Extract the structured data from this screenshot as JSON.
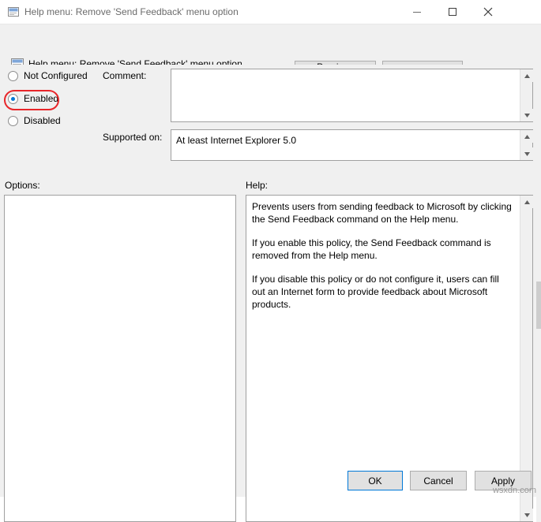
{
  "window": {
    "title": "Help menu: Remove 'Send Feedback' menu option",
    "icon": "policy-setting-icon",
    "minimize_icon": "minimize-icon",
    "maximize_icon": "maximize-icon",
    "close_icon": "close-icon"
  },
  "header": {
    "icon": "policy-setting-icon",
    "title": "Help menu: Remove 'Send Feedback' menu option",
    "previous_label": "Previous Setting",
    "next_label": "Next Setting"
  },
  "state_options": [
    {
      "label": "Not Configured",
      "checked": false
    },
    {
      "label": "Enabled",
      "checked": true
    },
    {
      "label": "Disabled",
      "checked": false
    }
  ],
  "labels": {
    "comment": "Comment:",
    "supported_on": "Supported on:",
    "options": "Options:",
    "help": "Help:"
  },
  "comment": {
    "value": "",
    "placeholder": ""
  },
  "supported_on": {
    "value": "At least Internet Explorer 5.0"
  },
  "help": {
    "paragraphs": [
      "Prevents users from sending feedback to Microsoft by clicking the Send Feedback command on the Help menu.",
      "If you enable this policy, the Send Feedback command is removed from the Help menu.",
      "If you disable this policy or do not configure it, users can fill out an Internet form to provide feedback about Microsoft products."
    ]
  },
  "buttons": {
    "ok": "OK",
    "cancel": "Cancel",
    "apply": "Apply"
  },
  "annotation": {
    "highlight_color": "#e8262a",
    "accent_color": "#0078d7"
  },
  "watermark": "wsxdn.com"
}
